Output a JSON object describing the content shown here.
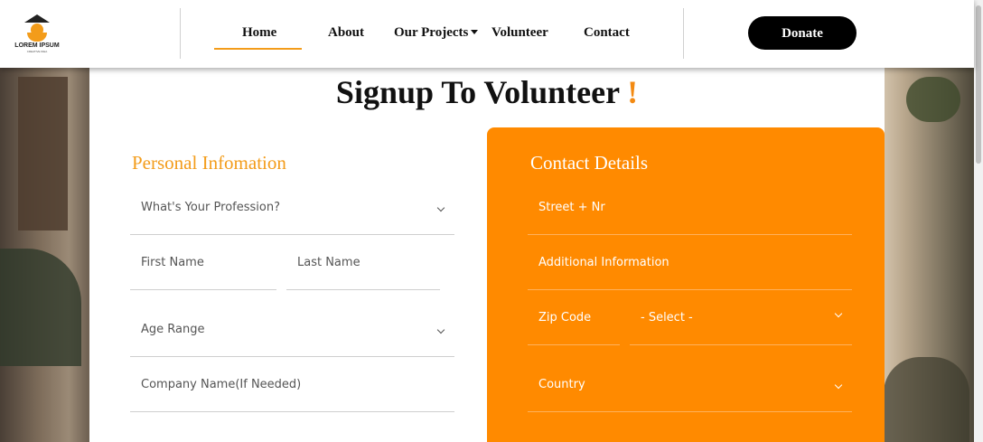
{
  "header": {
    "logo": {
      "text": "LOREM IPSUM",
      "tagline": "CREATIVE IDEA"
    },
    "nav": [
      "Home",
      "About",
      "Our Projects",
      "Volunteer",
      "Contact"
    ],
    "donate_label": "Donate"
  },
  "page": {
    "title": "Signup To Volunteer",
    "title_mark": "!"
  },
  "personal": {
    "heading": "Personal Infomation",
    "profession": "What's Your Profession?",
    "first_name": "First Name",
    "last_name": "Last Name",
    "age_range": "Age Range",
    "company": "Company Name(If Needed)"
  },
  "contact": {
    "heading": "Contact Details",
    "street": "Street + Nr",
    "additional": "Additional Information",
    "zip": "Zip Code",
    "select": "- Select -",
    "country": "Country"
  },
  "colors": {
    "accent": "#f39c1a",
    "panel": "#ff8a00",
    "button": "#000000"
  }
}
